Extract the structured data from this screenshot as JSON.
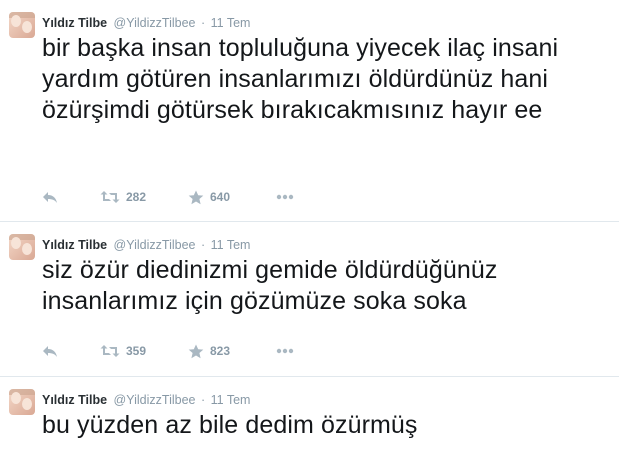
{
  "tweets": [
    {
      "author_name": "Yıldız Tilbe",
      "handle": "@YildizzTilbee",
      "separator": "·",
      "time": "11 Tem",
      "text": "bir başka insan topluluğuna yiyecek ilaç insani yardım götüren insanlarımızı öldürdünüz hani özürşimdi götürsek bırakıcakmısınız hayır ee",
      "retweets": "282",
      "favorites": "640"
    },
    {
      "author_name": "Yıldız Tilbe",
      "handle": "@YildizzTilbee",
      "separator": "·",
      "time": "11 Tem",
      "text": "siz özür diedinizmi gemide öldürdüğünüz insanlarımız için gözümüze soka soka",
      "retweets": "359",
      "favorites": "823"
    },
    {
      "author_name": "Yıldız Tilbe",
      "handle": "@YildizzTilbee",
      "separator": "·",
      "time": "11 Tem",
      "text": "bu yüzden az bile dedim özürmüş"
    }
  ],
  "icons": {
    "reply": "reply-icon",
    "retweet": "retweet-icon",
    "favorite": "star-icon",
    "more": "more-icon"
  },
  "colors": {
    "icon": "#aab8c2",
    "meta": "#8899a6",
    "text": "#14171a",
    "divider": "#e1e8ed"
  }
}
